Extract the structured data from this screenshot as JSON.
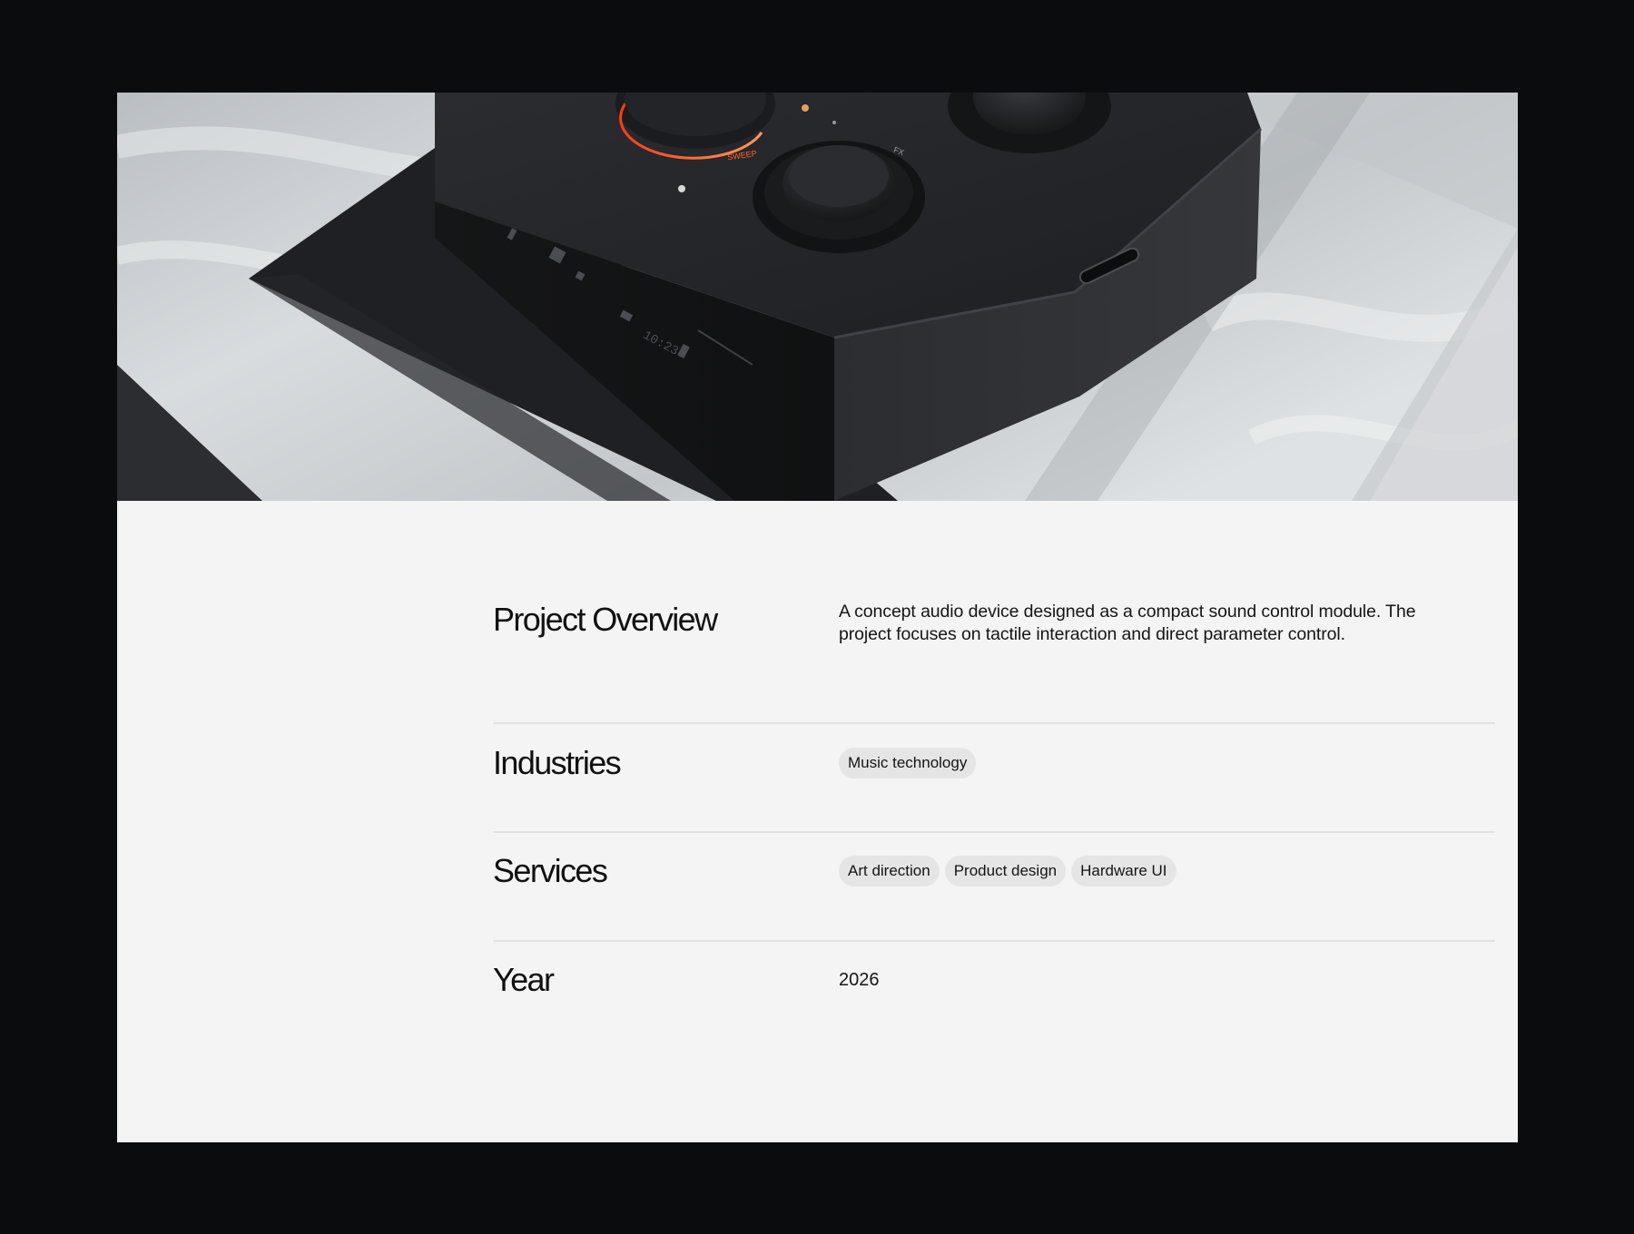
{
  "hero": {
    "image": "concept audio device product photo",
    "device_markings": [
      "SWEEP",
      "FX",
      "10:23"
    ]
  },
  "details": {
    "overview": {
      "label": "Project Overview",
      "text": "A concept audio device designed as a compact sound control module. The project focuses on tactile interaction and direct parameter control."
    },
    "industries": {
      "label": "Industries",
      "tags": [
        "Music technology"
      ]
    },
    "services": {
      "label": "Services",
      "tags": [
        "Art direction",
        "Product design",
        "Hardware UI"
      ]
    },
    "year": {
      "label": "Year",
      "value": "2026"
    }
  },
  "colors": {
    "background": "#0b0c0d",
    "panel": "#f4f4f4",
    "tag_bg": "#e5e5e5",
    "accent_led": "#ff6a2b"
  }
}
